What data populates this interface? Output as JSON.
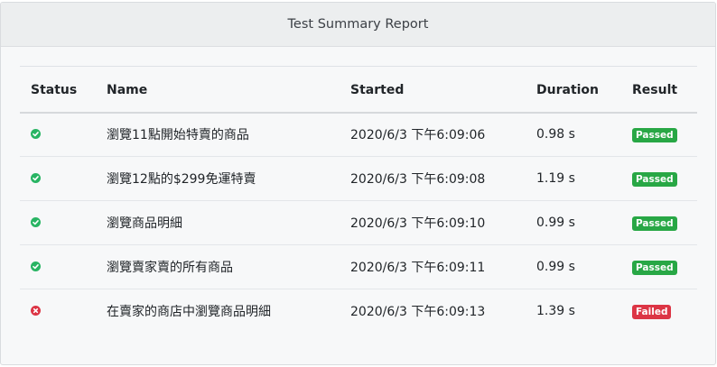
{
  "report": {
    "title": "Test Summary Report",
    "columns": {
      "status": "Status",
      "name": "Name",
      "started": "Started",
      "duration": "Duration",
      "result": "Result"
    },
    "rows": [
      {
        "status": "check-circle-icon",
        "name": "瀏覽11點開始特賣的商品",
        "started": "2020/6/3 下午6:09:06",
        "duration": "0.98 s",
        "result": "Passed"
      },
      {
        "status": "check-circle-icon",
        "name": "瀏覽12點的$299免運特賣",
        "started": "2020/6/3 下午6:09:08",
        "duration": "1.19 s",
        "result": "Passed"
      },
      {
        "status": "check-circle-icon",
        "name": "瀏覽商品明細",
        "started": "2020/6/3 下午6:09:10",
        "duration": "0.99 s",
        "result": "Passed"
      },
      {
        "status": "check-circle-icon",
        "name": "瀏覽賣家賣的所有商品",
        "started": "2020/6/3 下午6:09:11",
        "duration": "0.99 s",
        "result": "Passed"
      },
      {
        "status": "x-circle-icon",
        "name": "在賣家的商店中瀏覽商品明細",
        "started": "2020/6/3 下午6:09:13",
        "duration": "1.39 s",
        "result": "Failed"
      }
    ]
  },
  "colors": {
    "passed": "#28a745",
    "failed": "#dc3545",
    "header_bg": "#eceeef",
    "card_bg": "#f7f8f9"
  }
}
